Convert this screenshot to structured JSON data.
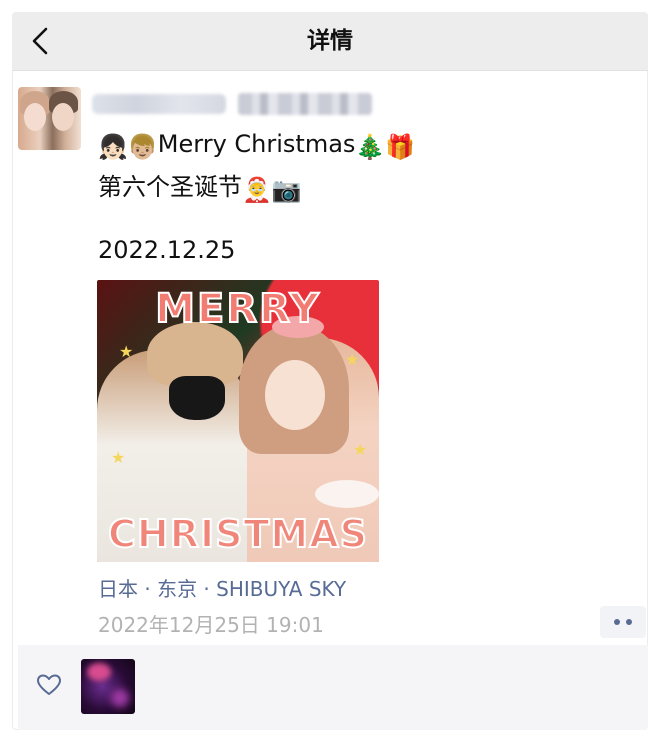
{
  "navbar": {
    "title": "详情"
  },
  "post": {
    "line1_text": "Merry Christmas",
    "line1_emojis_before": [
      "👧🏻",
      "👦🏼"
    ],
    "line1_emojis_after": [
      "🎄",
      "🎁"
    ],
    "line2_text": "第六个圣诞节",
    "line2_emojis": [
      "🤶",
      "📷"
    ],
    "date_text": "2022.12.25",
    "photo": {
      "top_text": "MERRY",
      "bottom_text": "CHRISTMAS"
    },
    "location": "日本 · 东京 · SHIBUYA SKY",
    "timestamp": "2022年12月25日 19:01"
  },
  "icons": {
    "back": "chevron-left-icon",
    "more": "more-dots-icon",
    "like": "heart-outline-icon"
  },
  "colors": {
    "navbar_bg": "#ededed",
    "link_blue": "#576b95",
    "timestamp_gray": "#b2b2b2",
    "likes_bg": "#f5f5f7"
  }
}
